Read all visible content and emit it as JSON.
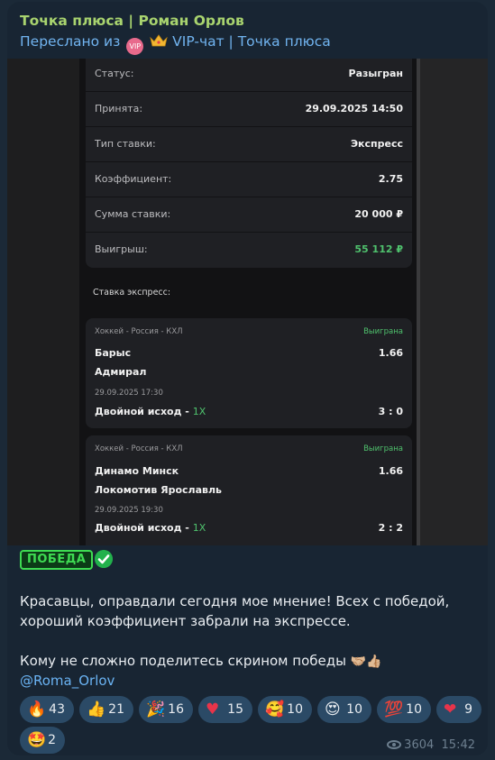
{
  "message": {
    "sender": "Точка плюса | Роман Орлов",
    "forwarded_prefix": "Переслано из",
    "forwarded_vip_badge": "VIP",
    "forwarded_from": "VIP-чат | Точка плюса"
  },
  "bet_info": {
    "rows": [
      {
        "label": "Статус:",
        "value": "Разыгран"
      },
      {
        "label": "Принята:",
        "value": "29.09.2025 14:50"
      },
      {
        "label": "Тип ставки:",
        "value": "Экспресс"
      },
      {
        "label": "Коэффициент:",
        "value": "2.75"
      },
      {
        "label": "Сумма ставки:",
        "value": "20 000 ₽"
      },
      {
        "label": "Выигрыш:",
        "value": "55 112 ₽"
      }
    ],
    "section_title": "Ставка экспресс:",
    "events": [
      {
        "league": "Хоккей - Россия - КХЛ",
        "status": "Выиграна",
        "team1": "Барыс",
        "team2": "Адмирал",
        "odd": "1.66",
        "datetime": "29.09.2025 17:30",
        "bet_type": "Двойной исход - ",
        "selection": "1X",
        "score": "3 : 0"
      },
      {
        "league": "Хоккей - Россия - КХЛ",
        "status": "Выиграна",
        "team1": "Динамо Минск",
        "team2": "Локомотив Ярославль",
        "odd": "1.66",
        "datetime": "29.09.2025 19:30",
        "bet_type": "Двойной исход - ",
        "selection": "1X",
        "score": "2 : 2"
      }
    ]
  },
  "caption": {
    "badge": "ПОБЕДА",
    "line1": "Красавцы, оправдали сегодня мое мнение! Всех с победой,",
    "line2": "хороший коэффициент забрали на экспрессе.",
    "line3": "Кому не сложно поделитесь скрином победы",
    "mention": "@Roma_Orlov"
  },
  "reactions": [
    {
      "emoji": "🔥",
      "count": "43"
    },
    {
      "emoji": "👍",
      "count": "21"
    },
    {
      "emoji": "🎉",
      "count": "16"
    },
    {
      "emoji": "♥",
      "count": "15"
    },
    {
      "emoji": "🥰",
      "count": "10"
    },
    {
      "emoji": "😍",
      "count": "10"
    },
    {
      "emoji": "💯",
      "count": "10"
    },
    {
      "emoji": "❤",
      "count": "9"
    },
    {
      "emoji": "🤩",
      "count": "2"
    }
  ],
  "meta": {
    "views": "3604",
    "time": "15:42"
  },
  "colors": {
    "bg": "#182533",
    "accent_green": "#4fc16d",
    "link": "#6ab3f3",
    "sender": "#a9d46f",
    "reaction_bg": "#2b4a66"
  }
}
